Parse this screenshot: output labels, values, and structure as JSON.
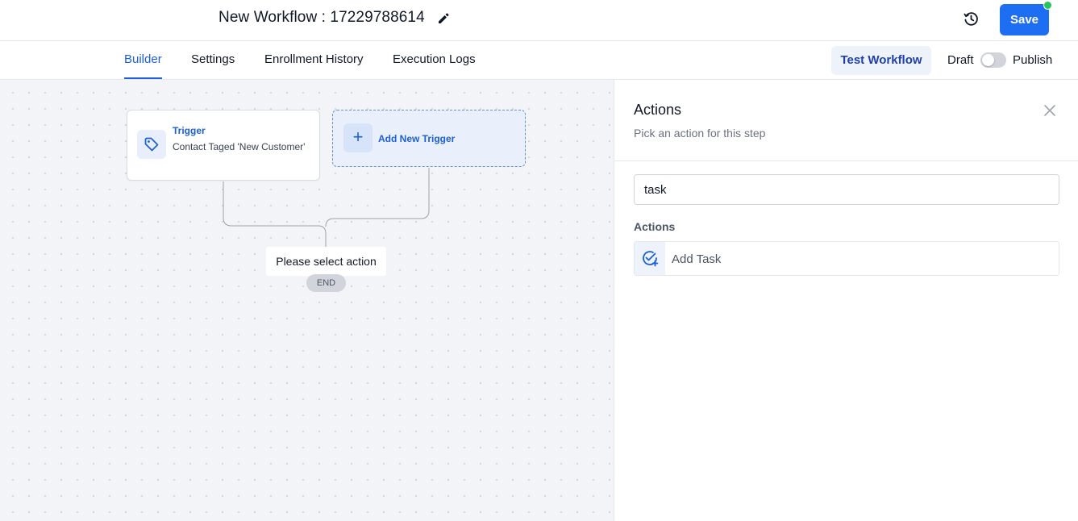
{
  "header": {
    "workflow_title": "New Workflow : 17229788614",
    "save_label": "Save",
    "edit_icon": "pencil-icon",
    "history_icon": "history-icon"
  },
  "tabs": [
    {
      "label": "Builder",
      "active": true
    },
    {
      "label": "Settings",
      "active": false
    },
    {
      "label": "Enrollment History",
      "active": false
    },
    {
      "label": "Execution Logs",
      "active": false
    }
  ],
  "toolbar": {
    "test_workflow_label": "Test Workflow",
    "draft_label": "Draft",
    "publish_label": "Publish",
    "published": false
  },
  "canvas": {
    "trigger": {
      "title": "Trigger",
      "description": "Contact Taged 'New Customer'",
      "icon": "tag-icon"
    },
    "add_trigger_label": "Add New Trigger",
    "select_action_label": "Please select action",
    "end_label": "END"
  },
  "panel": {
    "title": "Actions",
    "subtitle": "Pick an action for this step",
    "search_value": "task",
    "section_label": "Actions",
    "items": [
      {
        "label": "Add Task",
        "icon": "task-add-icon"
      }
    ]
  },
  "colors": {
    "primary": "#1d6ef3",
    "accent_text": "#1d5fd6",
    "status_dot": "#22c55e",
    "canvas_bg": "#f2f4f7"
  }
}
